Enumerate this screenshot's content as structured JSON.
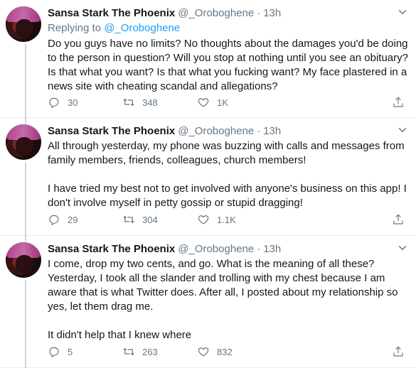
{
  "tweets": [
    {
      "name": "Sansa Stark The Phoenix",
      "handle": "@_Oroboghene",
      "separator": "·",
      "time": "13h",
      "replying_prefix": "Replying to ",
      "replying_to": "@_Oroboghene",
      "text": "Do you guys have no limits? No thoughts about the damages you'd be doing to the person in question? Will you stop at nothing until you see an obituary? Is that what you want? Is that what you fucking want? My face plastered in a news site with cheating scandal and allegations?",
      "replies": "30",
      "retweets": "348",
      "likes": "1K"
    },
    {
      "name": "Sansa Stark The Phoenix",
      "handle": "@_Oroboghene",
      "separator": "·",
      "time": "13h",
      "text": "All through yesterday, my phone was buzzing with calls and messages from family members, friends, colleagues, church members!\n\nI have tried my best not to get involved with anyone's business on this app! I don't involve myself in petty gossip or stupid dragging!",
      "replies": "29",
      "retweets": "304",
      "likes": "1.1K"
    },
    {
      "name": "Sansa Stark The Phoenix",
      "handle": "@_Oroboghene",
      "separator": "·",
      "time": "13h",
      "text": "I come, drop my two cents, and go. What is the meaning of all these? Yesterday, I took all the slander and trolling with my chest because I am aware that is what Twitter does. After all, I posted about my relationship so yes, let them drag me.\n\nIt didn't help that I knew where",
      "replies": "5",
      "retweets": "263",
      "likes": "832"
    }
  ],
  "colors": {
    "accent": "#1da1f2",
    "muted": "#657786",
    "text": "#14171a",
    "divider": "#e6ecf0"
  },
  "icons": [
    "reply-icon",
    "retweet-icon",
    "like-icon",
    "share-icon",
    "caret-down-icon"
  ]
}
